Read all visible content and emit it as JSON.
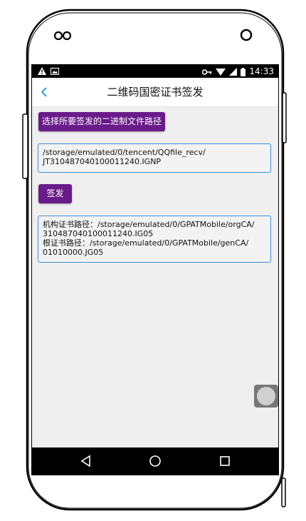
{
  "status_bar": {
    "time": "14:33",
    "icons": [
      "warning-icon",
      "image-icon",
      "key-icon",
      "wifi-icon",
      "signal-icon",
      "battery-icon"
    ]
  },
  "app_bar": {
    "title": "二维码国密证书签发",
    "back_icon": "chevron-left-icon"
  },
  "main": {
    "choose_button_label": "选择所要签发的二进制文件路径",
    "file_path_line1": "/storage/emulated/0/tencent/QQfile_recv/",
    "file_path_line2": "JT310487040100011240.IGNP",
    "sign_button_label": "签发",
    "result_line1": "机构证书路径：/storage/emulated/0/GPATMobile/orgCA/",
    "result_line2": "310487040100011240.IG05",
    "result_line3": "根证书路径：/storage/emulated/0/GPATMobile/genCA/",
    "result_line4": "01010000.JG05"
  },
  "nav_bar": {
    "icons": [
      "back-triangle-icon",
      "home-circle-icon",
      "recents-square-icon"
    ]
  },
  "colors": {
    "accent_purple": "#6a1b8a",
    "field_border": "#3b8fd6",
    "back_arrow": "#2196f3"
  }
}
